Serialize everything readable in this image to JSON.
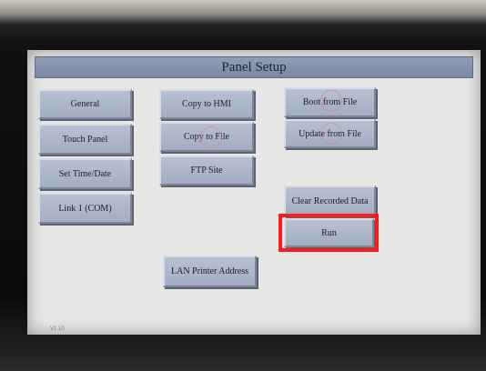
{
  "panel": {
    "title": "Panel Setup",
    "version": "V1.10"
  },
  "buttons": {
    "general": "General",
    "touch_panel": "Touch Panel",
    "set_time_date": "Set Time/Date",
    "link1_com": "Link 1 (COM)",
    "copy_to_hmi": "Copy to HMI",
    "copy_to_file": "Copy to File",
    "ftp_site": "FTP Site",
    "lan_printer_address": "LAN Printer Address",
    "boot_from_file": "Boot from File",
    "update_from_file": "Update from File",
    "clear_recorded_data": "Clear Recorded Data",
    "run": "Run"
  },
  "colors": {
    "highlight": "#ff1a1a",
    "title_bar": "#8f9db6",
    "button_face": "#aeb7c9"
  }
}
